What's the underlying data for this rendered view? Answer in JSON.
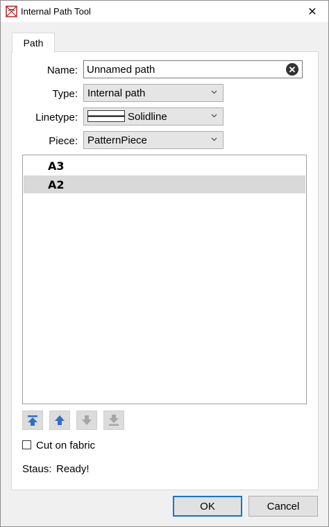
{
  "window": {
    "title": "Internal Path Tool",
    "close_glyph": "✕"
  },
  "tabs": [
    {
      "label": "Path"
    }
  ],
  "form": {
    "name_label": "Name:",
    "name_value": "Unnamed path",
    "type_label": "Type:",
    "type_value": "Internal path",
    "linetype_label": "Linetype:",
    "linetype_value": "Solidline",
    "piece_label": "Piece:",
    "piece_value": "PatternPiece"
  },
  "path_list": {
    "items": [
      {
        "label": "A3",
        "selected": false
      },
      {
        "label": "A2",
        "selected": true
      }
    ]
  },
  "move_buttons": [
    {
      "icon": "move-top-icon",
      "enabled": true
    },
    {
      "icon": "move-up-icon",
      "enabled": true
    },
    {
      "icon": "move-down-icon",
      "enabled": false
    },
    {
      "icon": "move-bottom-icon",
      "enabled": false
    }
  ],
  "options": {
    "cut_on_fabric_label": "Cut on fabric",
    "cut_on_fabric_checked": false
  },
  "status": {
    "label": "Staus:",
    "value": "Ready!"
  },
  "buttons": {
    "ok": "OK",
    "cancel": "Cancel"
  },
  "colors": {
    "accent": "#0078d7",
    "arrow_enabled": "#2f6fc9",
    "arrow_disabled": "#a6a6a6"
  }
}
